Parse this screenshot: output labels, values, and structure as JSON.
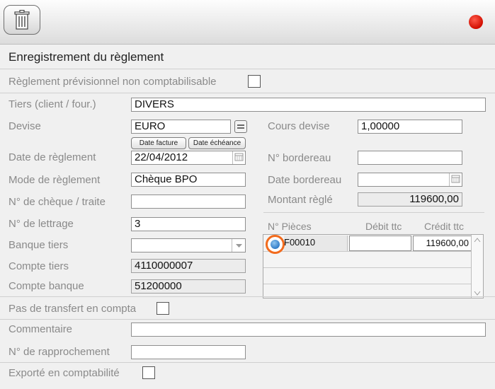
{
  "toolbar": {
    "delete_icon": "trash-icon",
    "close_icon": "red-circle-icon"
  },
  "form": {
    "title": "Enregistrement du règlement",
    "previsionnel_label": "Règlement prévisionnel non comptabilisable",
    "tiers_label": "Tiers (client  / four.)",
    "tiers_value": "DIVERS",
    "devise_label": "Devise",
    "devise_value": "EURO",
    "btn_date_facture": "Date facture",
    "btn_date_echeance": "Date échéance",
    "cours_label": "Cours devise",
    "cours_value": "1,00000",
    "date_reglement_label": "Date de règlement",
    "date_reglement_value": "22/04/2012",
    "bordereau_label": "N° bordereau",
    "bordereau_value": "",
    "mode_label": "Mode de règlement",
    "mode_value": "Chèque BPO",
    "date_bordereau_label": "Date bordereau",
    "date_bordereau_value": "",
    "cheque_label": "N° de chèque / traite",
    "cheque_value": "",
    "montant_label": "Montant règlé",
    "montant_value": "119600,00",
    "lettrage_label": "N° de lettrage",
    "lettrage_value": "3",
    "banque_label": "Banque tiers",
    "banque_value": "",
    "compte_tiers_label": "Compte tiers",
    "compte_tiers_value": "4110000007",
    "compte_banque_label": "Compte banque",
    "compte_banque_value": "51200000",
    "transfert_label": "Pas de transfert en compta",
    "commentaire_label": "Commentaire",
    "commentaire_value": "",
    "rapprochement_label": "N° de rapprochement",
    "rapprochement_value": "",
    "exporte_label": "Exporté en comptabilité"
  },
  "pieces": {
    "columns": [
      "N° Pièces",
      "Débit ttc",
      "Crédit ttc"
    ],
    "rows": [
      {
        "piece": "F00010",
        "debit": "",
        "credit": "119600,00"
      }
    ]
  },
  "colors": {
    "highlight_ring": "#f26b1d",
    "close_dot": "#d10e00"
  }
}
